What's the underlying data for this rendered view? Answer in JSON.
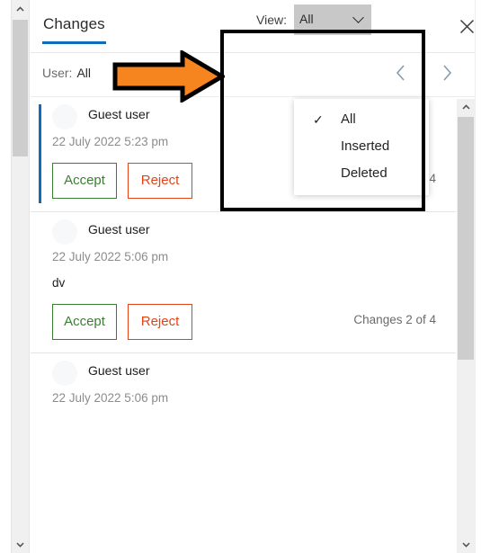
{
  "panel": {
    "title": "Changes",
    "close_icon": "close-icon"
  },
  "toolbar": {
    "user_filter_label": "User:",
    "user_filter_value": "All",
    "view_filter_label": "View:",
    "view_filter_value": "All",
    "prev_icon": "‹",
    "next_icon": "›",
    "more_options_icon": "kebab-menu-icon"
  },
  "view_dropdown": {
    "open": true,
    "check_glyph": "✓",
    "options": [
      {
        "label": "All",
        "checked": true
      },
      {
        "label": "Inserted",
        "checked": false
      },
      {
        "label": "Deleted",
        "checked": false
      }
    ]
  },
  "changes": [
    {
      "author": "Guest user",
      "date": "22 July 2022 5:23 pm",
      "body": "",
      "accept_label": "Accept",
      "reject_label": "Reject",
      "counter": "Changes 1 of 4",
      "selected": true
    },
    {
      "author": "Guest user",
      "date": "22 July 2022 5:06 pm",
      "body": "dv",
      "accept_label": "Accept",
      "reject_label": "Reject",
      "counter": "Changes 2 of 4",
      "selected": false
    },
    {
      "author": "Guest user",
      "date": "22 July 2022 5:06 pm",
      "body": "",
      "accept_label": "Accept",
      "reject_label": "Reject",
      "counter": "",
      "selected": false
    }
  ],
  "scrollbars": {
    "up_arrow": "▲",
    "down_arrow": "▼"
  },
  "annotations": {
    "highlight_box_color": "#000000",
    "arrow_color": "#F7851F",
    "arrow_outline_color": "#000000"
  },
  "colors": {
    "accent_blue": "#0F6CBD",
    "accept_green": "#3C7D34",
    "reject_red": "#E34317",
    "select_gray": "#C8C8C8"
  }
}
